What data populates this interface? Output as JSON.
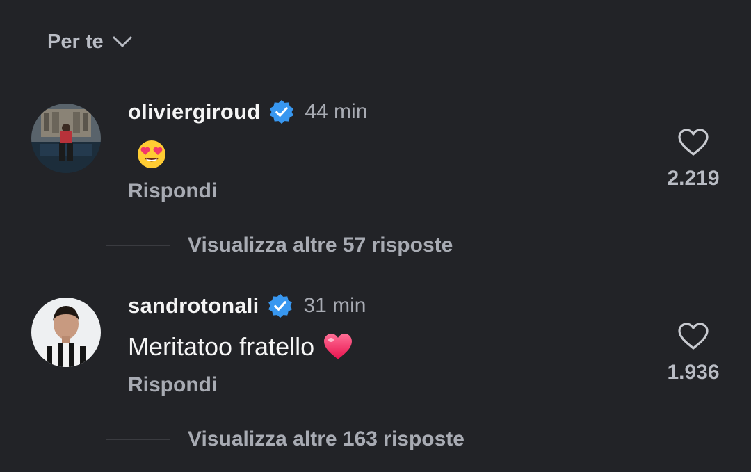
{
  "header": {
    "sort_label": "Per te"
  },
  "comments": [
    {
      "username": "oliviergiroud",
      "verified": true,
      "time": "44 min",
      "text": "",
      "emoji": "heart-eyes",
      "reply_label": "Rispondi",
      "likes": "2.219",
      "more_replies": "Visualizza altre 57 risposte"
    },
    {
      "username": "sandrotonali",
      "verified": true,
      "time": "31 min",
      "text": "Meritatoo fratello",
      "emoji": "red-heart",
      "reply_label": "Rispondi",
      "likes": "1.936",
      "more_replies": "Visualizza altre 163 risposte"
    }
  ],
  "colors": {
    "background": "#222327",
    "verified_blue": "#3897f0",
    "secondary_text": "#a8abb3"
  }
}
